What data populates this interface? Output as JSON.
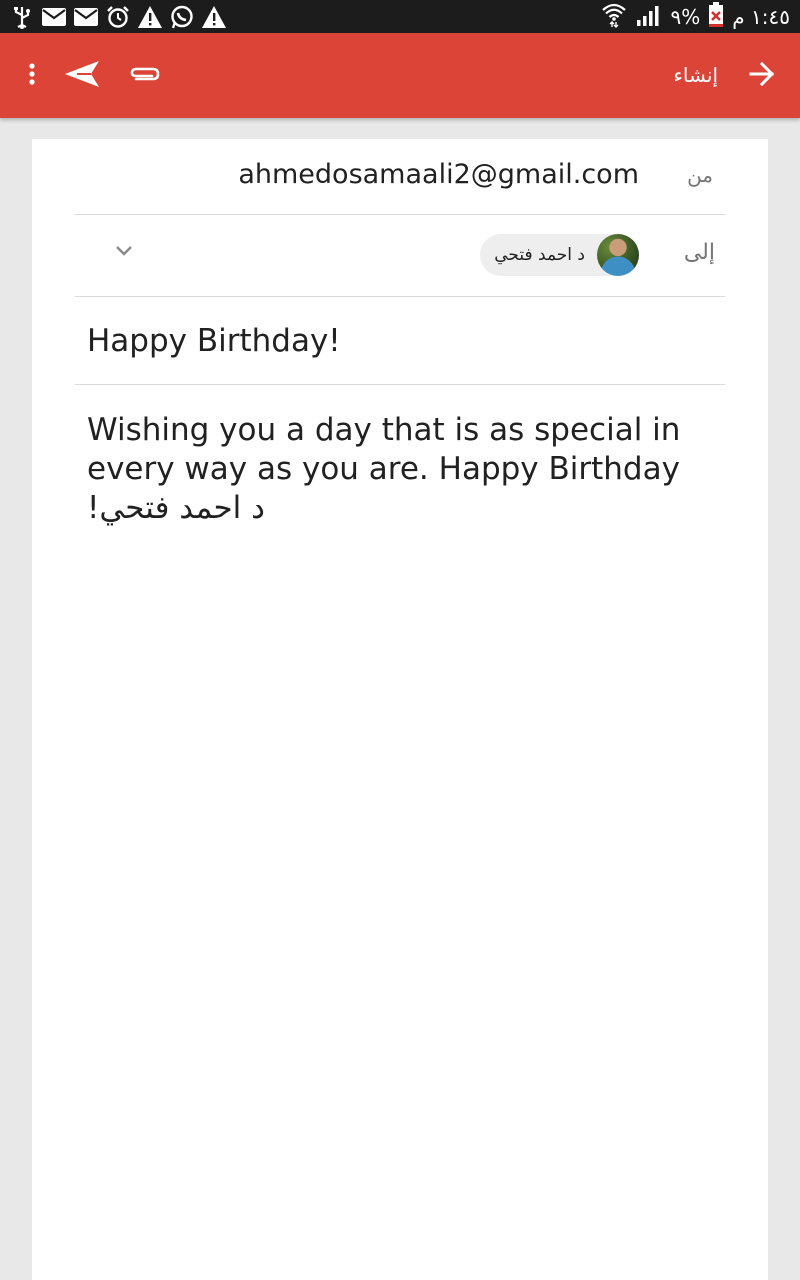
{
  "status_bar": {
    "time": "١:٤٥ م",
    "battery_percent": "٩%",
    "left_icons": [
      "usb-icon",
      "mail-icon",
      "mail-icon",
      "alarm-icon",
      "warning-icon",
      "whatsapp-icon",
      "warning-icon"
    ],
    "right_icons": [
      "wifi-icon",
      "signal-icon",
      "battery-icon"
    ]
  },
  "app_bar": {
    "title": "إنشاء",
    "color": "#db4437",
    "icons": {
      "back": "arrow-icon",
      "send": "send-icon",
      "attach": "paperclip-icon",
      "more": "more-vertical-icon"
    }
  },
  "compose": {
    "from_label": "من",
    "from_value": "ahmedosamaali2@gmail.com",
    "to_label": "إلى",
    "to_recipient": "د احمد فتحي",
    "subject": "Happy Birthday!",
    "body_ltr": "Wishing you a day that is as special in every way as you are. Happy Birthday",
    "body_rtl": "د احمد فتحي!"
  }
}
